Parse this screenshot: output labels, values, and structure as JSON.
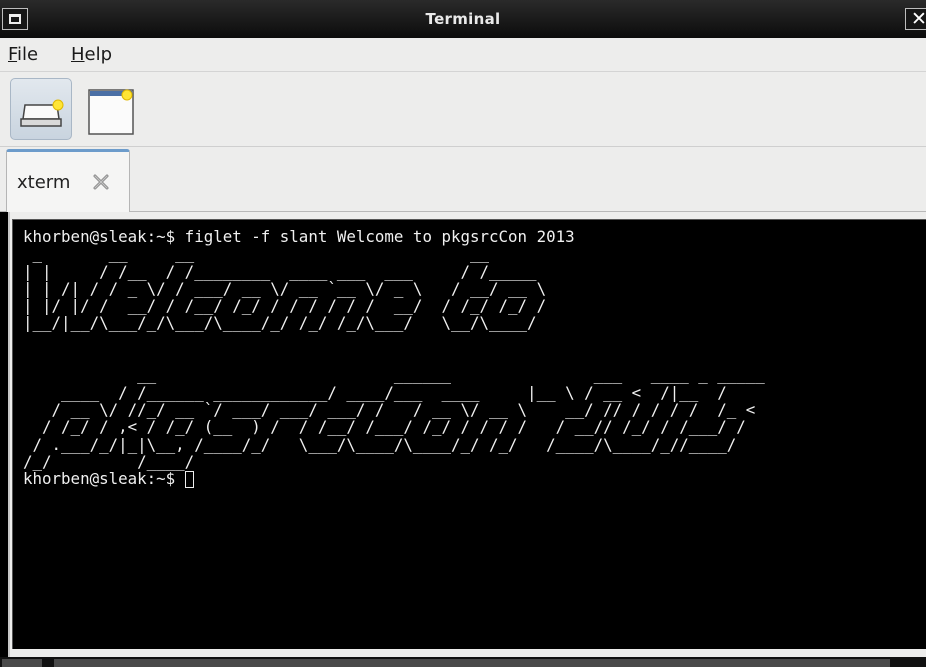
{
  "window": {
    "title": "Terminal",
    "close_glyph": "✕",
    "menu_icon": "window-menu-icon"
  },
  "menubar": {
    "items": [
      {
        "accel": "F",
        "rest": "ile"
      },
      {
        "accel": "H",
        "rest": "elp"
      }
    ]
  },
  "toolbar": {
    "buttons": [
      {
        "icon": "new-terminal-icon",
        "active": true
      },
      {
        "icon": "new-window-icon",
        "active": false
      }
    ]
  },
  "tabs": [
    {
      "label": "xterm",
      "close_icon": "tab-close-icon"
    }
  ],
  "terminal": {
    "command_line": "khorben@sleak:~$ figlet -f slant Welcome to pkgsrcCon 2013",
    "figlet_output": [
      " _       __     __                             __      ",
      "| |     / /__  / /________  ____ ___  ___     / /_____ ",
      "| | /| / / _ \\/ / ___/ __ \\/ __ `__ \\/ _ \\   / __/ __ \\",
      "| |/ |/ /  __/ / /__/ /_/ / / / / / /  __/  / /_/ /_/ /",
      "|__/|__/\\___/_/\\___/\\____/_/ /_/ /_/\\___/   \\__/\\____/ ",
      "",
      "",
      "            __                         ______               ___   ____ _ _____",
      "    ____  / /______ ____________/ ____/___  ____     |__ \\ / __ <  /|__  /",
      "   / __ \\/ //_/ __ `/ ___/ ___/ ___/ /   / __ \\/ __ \\    __/ // / / / /  /_ < ",
      "  / /_/ / ,< / /_/ (__  ) /  / /__/ /___/ /_/ / / / /   / __// /_/ / /___/ / ",
      " / .___/_/|_|\\__, /____/_/   \\___/\\____/\\____/_/ /_/   /____/\\____/_//____/  ",
      "/_/         /____/"
    ],
    "prompt": "khorben@sleak:~$ "
  },
  "colors": {
    "terminal_bg": "#000000",
    "terminal_fg": "#f0f0f0",
    "tab_accent": "#6d9ccb",
    "chrome_bg": "#ededec"
  }
}
